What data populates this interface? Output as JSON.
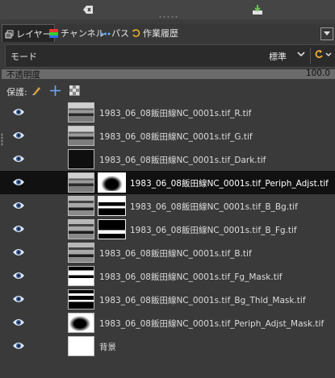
{
  "tabs": [
    {
      "label": "レイヤー",
      "icon": "layers-icon",
      "active": true
    },
    {
      "label": "チャンネル",
      "icon": "channels-icon",
      "active": false
    },
    {
      "label": "パス",
      "icon": "paths-icon",
      "active": false
    },
    {
      "label": "作業履歴",
      "icon": "undo-history-icon",
      "active": false
    }
  ],
  "mode": {
    "label": "モード",
    "value": "標準"
  },
  "opacity": {
    "label": "不透明度",
    "value": "100.0"
  },
  "protect": {
    "label": "保護:"
  },
  "layers": [
    {
      "name": "1983_06_08飯田線NC_0001s.tif_R.tif",
      "visible": true,
      "thumb": "photo",
      "mask": null,
      "selected": false
    },
    {
      "name": "1983_06_08飯田線NC_0001s.tif_G.tif",
      "visible": true,
      "thumb": "photo",
      "mask": null,
      "selected": false
    },
    {
      "name": "1983_06_08飯田線NC_0001s.tif_Dark.tif",
      "visible": true,
      "thumb": "dark",
      "mask": null,
      "selected": false
    },
    {
      "name": "1983_06_08飯田線NC_0001s.tif_Periph_Adjst.tif",
      "visible": true,
      "thumb": "photo",
      "mask": "periph",
      "selected": true
    },
    {
      "name": "1983_06_08飯田線NC_0001s.tif_B_Bg.tif",
      "visible": true,
      "thumb": "photo-b",
      "mask": "bbg",
      "selected": false
    },
    {
      "name": "1983_06_08飯田線NC_0001s.tif_B_Fg.tif",
      "visible": true,
      "thumb": "photo-b",
      "mask": "bfg",
      "selected": false
    },
    {
      "name": "1983_06_08飯田線NC_0001s.tif_B.tif",
      "visible": true,
      "thumb": "photo-b",
      "mask": null,
      "selected": false
    },
    {
      "name": "1983_06_08飯田線NC_0001s.tif_Fg_Mask.tif",
      "visible": true,
      "thumb": "fg",
      "mask": null,
      "selected": false
    },
    {
      "name": "1983_06_08飯田線NC_0001s.tif_Bg_Thld_Mask.tif",
      "visible": true,
      "thumb": "thld",
      "mask": null,
      "selected": false
    },
    {
      "name": "1983_06_08飯田線NC_0001s.tif_Periph_Adjst_Mask.tif",
      "visible": true,
      "thumb": "periph2",
      "mask": null,
      "selected": false
    },
    {
      "name": "背景",
      "visible": true,
      "thumb": "white",
      "mask": null,
      "selected": false
    }
  ],
  "colors": {
    "selected_row": "#111111",
    "panel_bg": "#3a3a3a",
    "eye": "#9fb8d8"
  }
}
